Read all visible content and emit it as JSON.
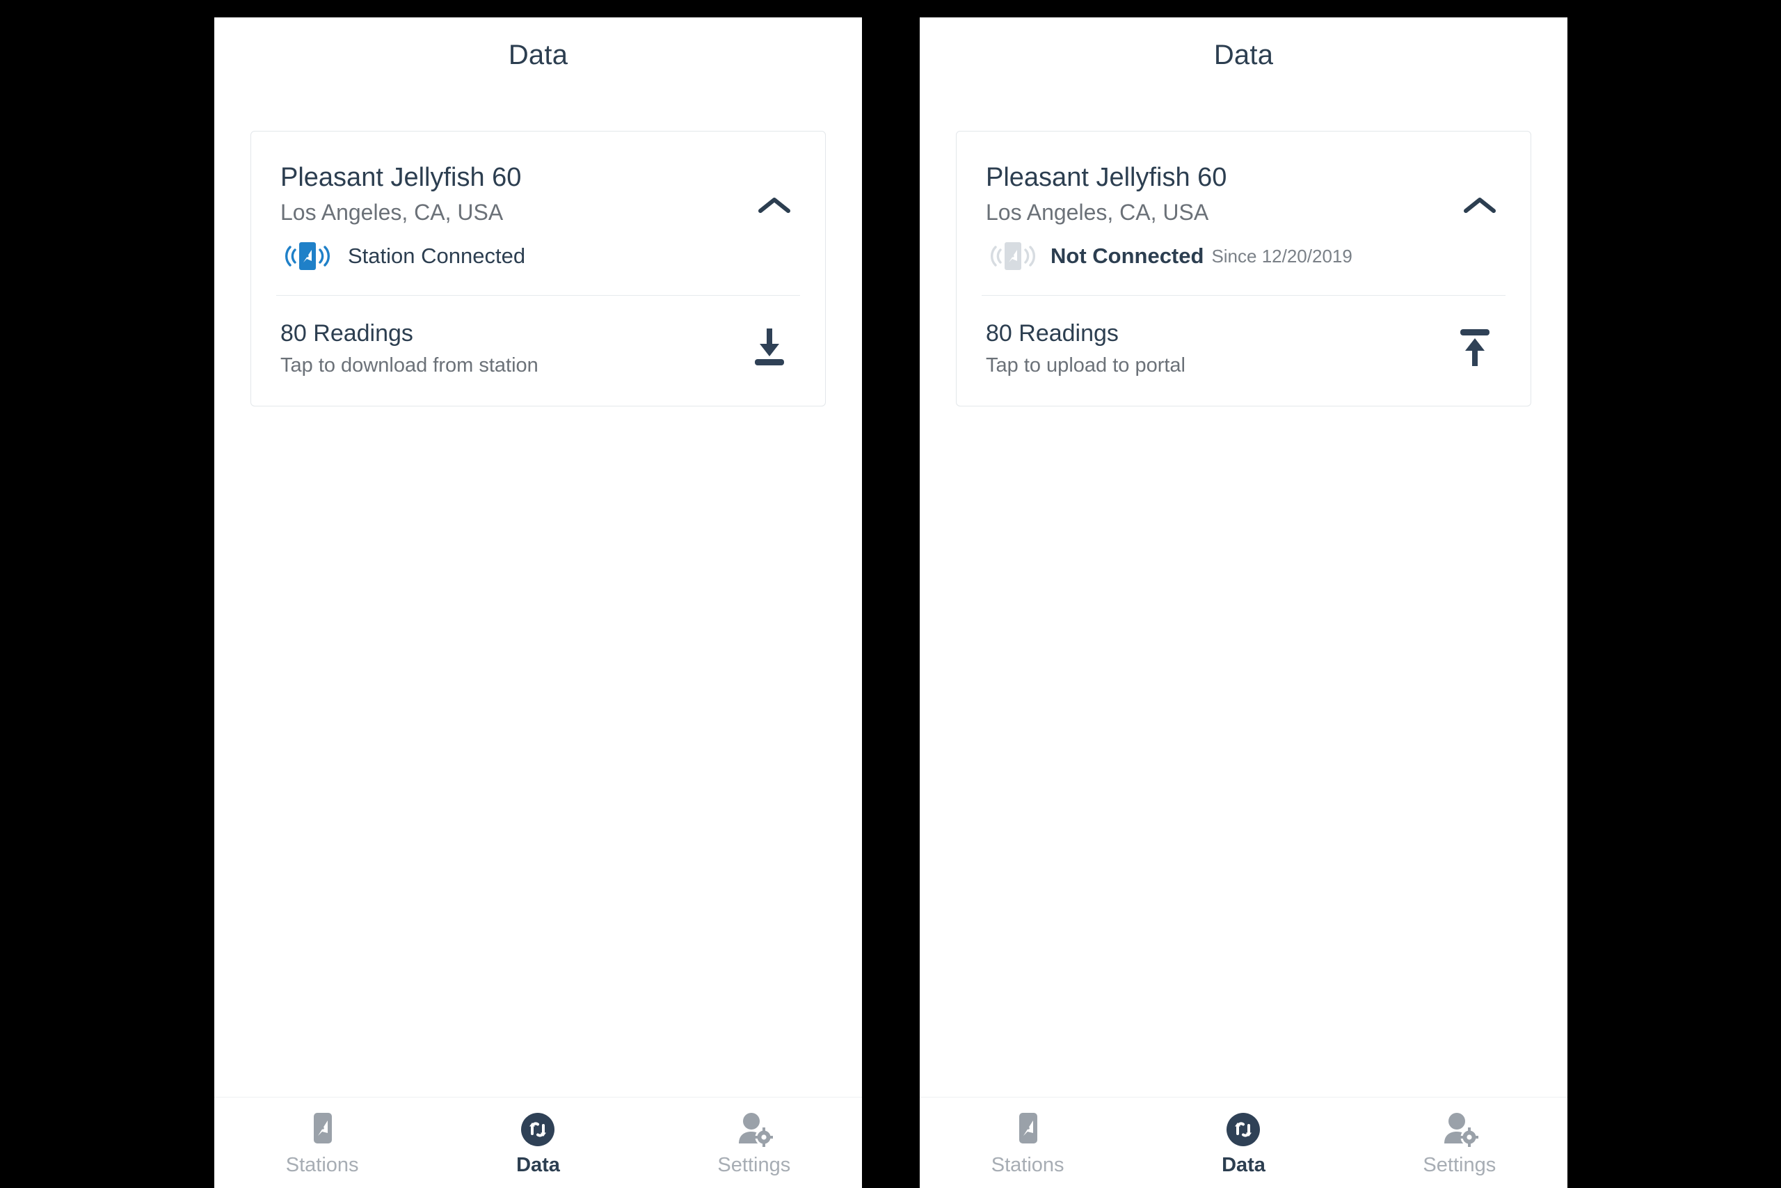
{
  "colors": {
    "accent_blue": "#1f80c8",
    "text_dark": "#2c3e50",
    "text_muted": "#6b7178",
    "icon_gray": "#9aa1a9",
    "disabled_gray": "#d3d8dd",
    "card_border": "#e3e7ea",
    "backdrop": "#000000"
  },
  "panels": [
    {
      "header": {
        "title": "Data"
      },
      "card": {
        "station_name": "Pleasant Jellyfish 60",
        "location": "Los Angeles, CA, USA",
        "status": {
          "icon": "station-connected-icon",
          "label": "Station Connected",
          "since": "",
          "connected": true
        },
        "collapse_icon": "chevron-up-icon",
        "readings": {
          "count_label": "80 Readings",
          "hint": "Tap to download from station",
          "action_icon": "download-icon"
        }
      },
      "nav": {
        "items": [
          {
            "label": "Stations",
            "icon": "compass-station-icon",
            "active": false
          },
          {
            "label": "Data",
            "icon": "sync-data-icon",
            "active": true
          },
          {
            "label": "Settings",
            "icon": "user-gear-icon",
            "active": false
          }
        ]
      }
    },
    {
      "header": {
        "title": "Data"
      },
      "card": {
        "station_name": "Pleasant Jellyfish 60",
        "location": "Los Angeles, CA, USA",
        "status": {
          "icon": "station-disconnected-icon",
          "label": "Not Connected",
          "since": "Since 12/20/2019",
          "connected": false
        },
        "collapse_icon": "chevron-up-icon",
        "readings": {
          "count_label": "80 Readings",
          "hint": "Tap to upload to portal",
          "action_icon": "upload-icon"
        }
      },
      "nav": {
        "items": [
          {
            "label": "Stations",
            "icon": "compass-station-icon",
            "active": false
          },
          {
            "label": "Data",
            "icon": "sync-data-icon",
            "active": true
          },
          {
            "label": "Settings",
            "icon": "user-gear-icon",
            "active": false
          }
        ]
      }
    }
  ]
}
